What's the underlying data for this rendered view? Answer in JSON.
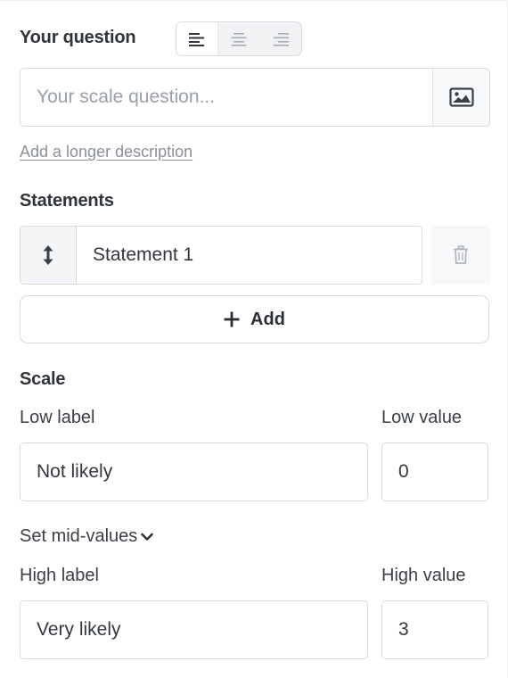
{
  "question": {
    "title": "Your question",
    "placeholder": "Your scale question...",
    "add_description_link": "Add a longer description",
    "alignment_options": [
      "align-left",
      "align-center",
      "align-right"
    ],
    "alignment_selected": "align-left"
  },
  "statements": {
    "title": "Statements",
    "items": [
      {
        "value": "Statement 1"
      }
    ],
    "add_label": "Add"
  },
  "scale": {
    "title": "Scale",
    "low_label_caption": "Low label",
    "low_value_caption": "Low value",
    "low_label_value": "Not likely",
    "low_value_value": "0",
    "mid_values_toggle": "Set mid-values",
    "high_label_caption": "High label",
    "high_value_caption": "High value",
    "high_label_value": "Very likely",
    "high_value_value": "3"
  },
  "colors": {
    "text": "#2f333a",
    "placeholder": "#9aa0a8",
    "border": "#d7dae0",
    "muted_bg": "#f4f5f7"
  }
}
